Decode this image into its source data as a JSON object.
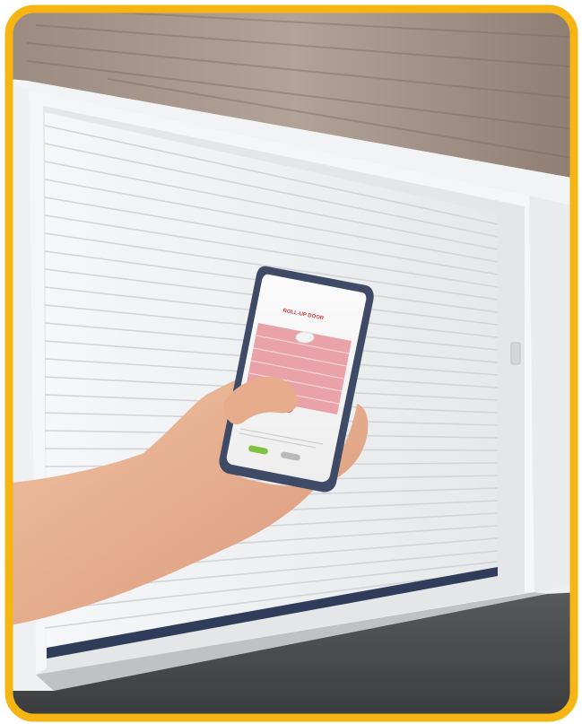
{
  "photo": {
    "subject": "hand-holding-smartphone-in-front-of-roller-garage-door",
    "frame_color": "#F6B512"
  },
  "phone": {
    "app_title": "ROLL-UP DOOR",
    "confirm_label": "",
    "cancel_label": ""
  },
  "colors": {
    "wall_wood": "#A8968A",
    "door_white": "#F4F5F6",
    "frame_white": "#EDEEEF",
    "floor": "#47484A",
    "screen_pink": "#E8A2A8",
    "screen_red": "#E0383F",
    "button_green": "#7FC241",
    "button_grey": "#B9B9B9",
    "skin": "#E9B18F",
    "phone_body": "#3E4A66"
  },
  "icons": [
    "door-open-icon",
    "power-button-icon"
  ]
}
